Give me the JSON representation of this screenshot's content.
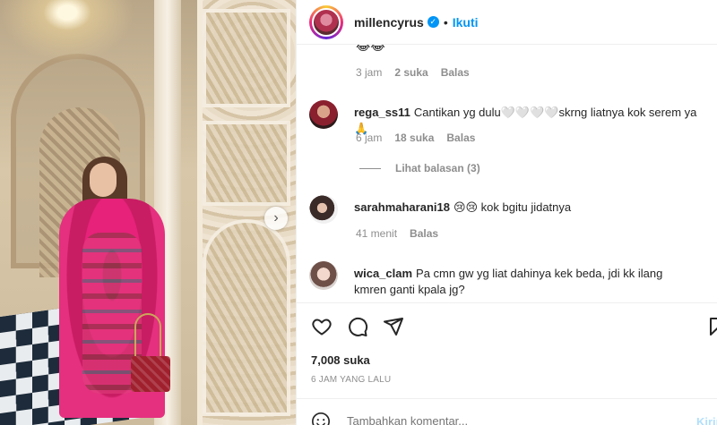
{
  "post": {
    "username": "millencyrus",
    "separator": "•",
    "follow_label": "Ikuti",
    "verified_icon": "verified-badge-icon"
  },
  "comments": {
    "top_partial": {
      "emoji": "😂😂",
      "time": "3 jam",
      "likes": "2 suka",
      "reply_label": "Balas"
    },
    "items": [
      {
        "user": "rega_ss11",
        "text": "Cantikan yg dulu🤍🤍🤍🤍skrng liatnya kok serem ya 🙏",
        "time": "6 jam",
        "likes": "18 suka",
        "reply_label": "Balas"
      },
      {
        "user": "sarahmaharani18",
        "text": "😢😢 kok bgitu jidatnya",
        "time": "41 menit",
        "reply_label": "Balas"
      },
      {
        "user": "wica_clam",
        "text": "Pa cmn gw yg liat dahinya kek beda, jdi kk ilang kmren ganti kpala jg?"
      }
    ],
    "view_replies": "Lihat balasan (3)"
  },
  "actions": {
    "like_icon": "heart-icon",
    "comment_icon": "comment-icon",
    "share_icon": "share-icon",
    "save_icon": "bookmark-icon",
    "likes": "7,008 suka",
    "posted": "6 JAM YANG LALU"
  },
  "composer": {
    "placeholder": "Tambahkan komentar...",
    "post_label": "Kirim"
  },
  "colors": {
    "accent": "#0095f6",
    "muted": "#8e8e8e",
    "text": "#262626"
  }
}
